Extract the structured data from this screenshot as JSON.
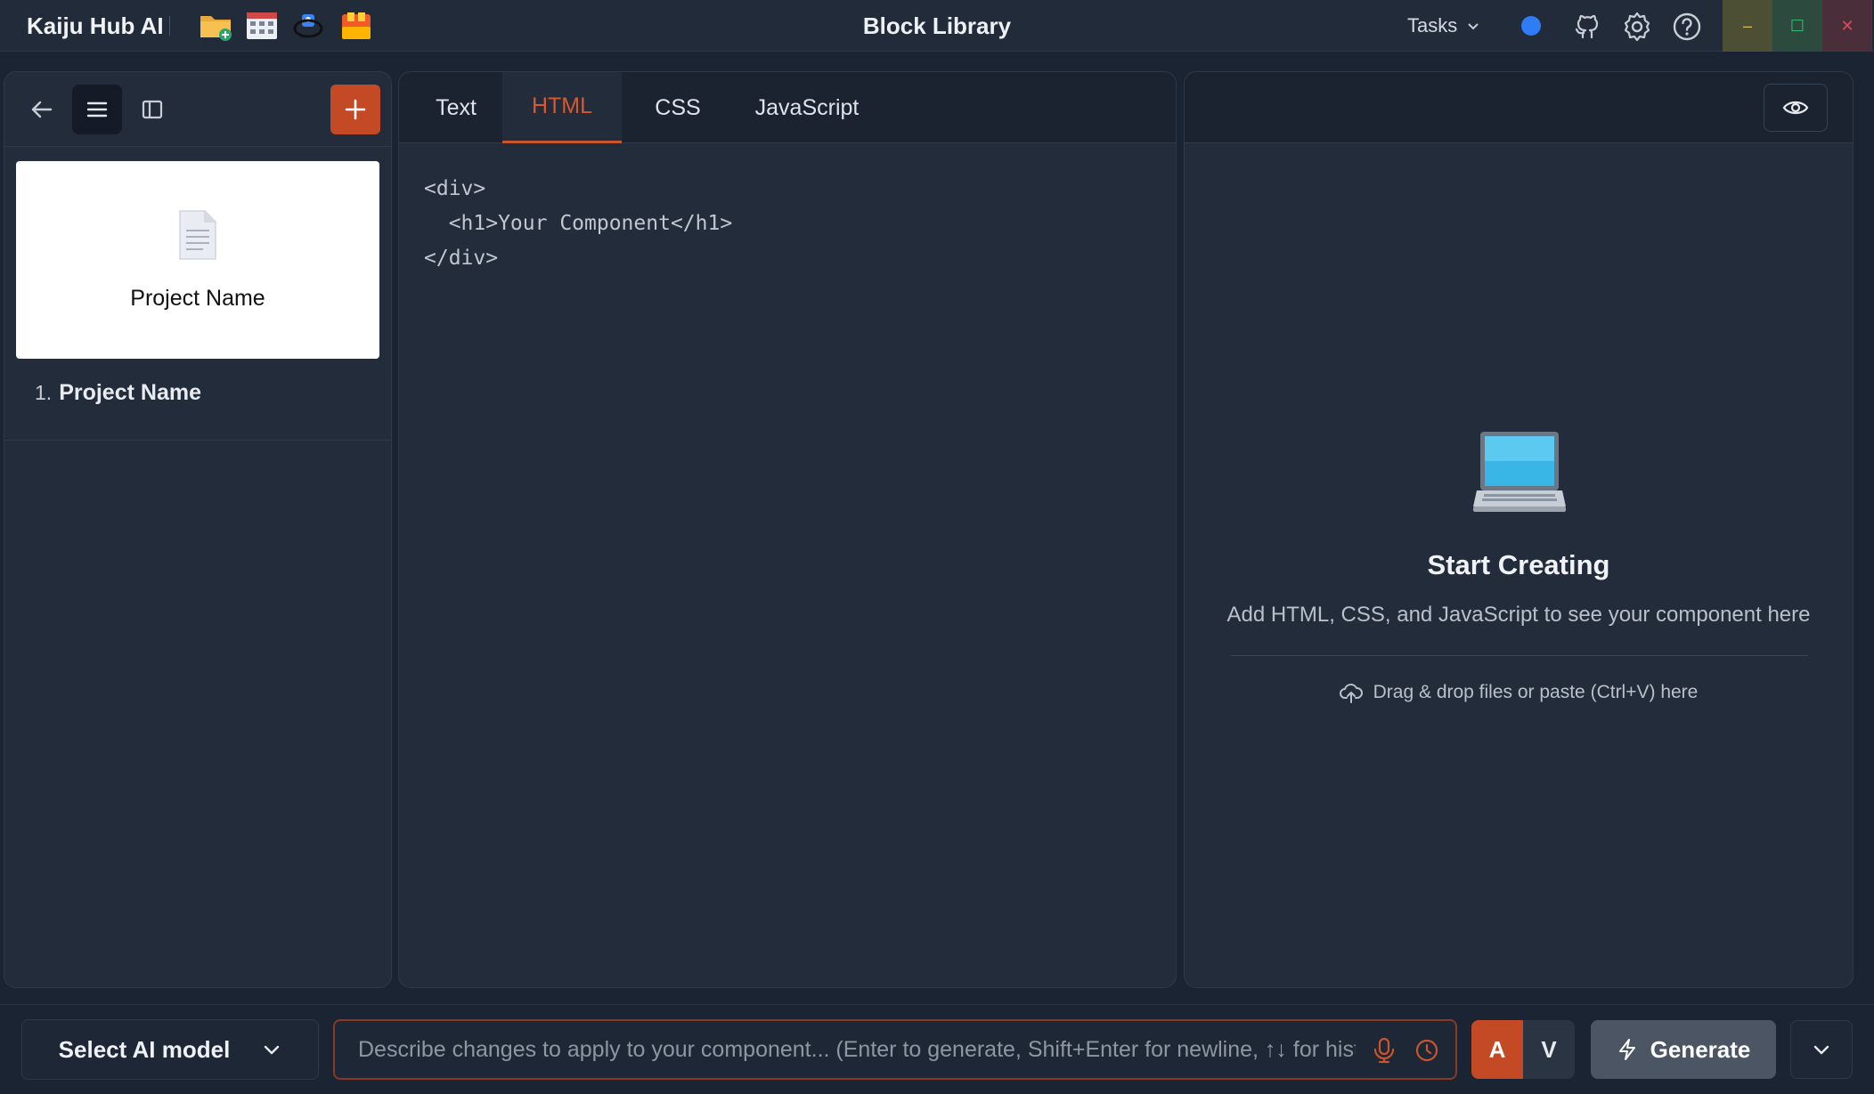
{
  "titlebar": {
    "app_name": "Kaiju Hub AI",
    "window_title": "Block Library",
    "tasks_label": "Tasks",
    "quick_icons": [
      "folder-add-icon",
      "calendar-grid-icon",
      "sync-app-icon",
      "palette-app-icon"
    ],
    "right_icons": [
      "status-dot",
      "github-icon",
      "gear-icon",
      "help-icon"
    ],
    "window_controls": [
      "minimize-icon",
      "maximize-icon",
      "close-icon"
    ],
    "minimize_glyph": "–",
    "maximize_glyph": "☐",
    "close_glyph": "✕"
  },
  "sidebar": {
    "card": {
      "title": "Project Name"
    },
    "items": [
      {
        "number": "1.",
        "label": "Project Name"
      }
    ]
  },
  "editor": {
    "tabs": [
      {
        "label": "Text",
        "active": false
      },
      {
        "label": "HTML",
        "active": true
      },
      {
        "label": "CSS",
        "active": false
      },
      {
        "label": "JavaScript",
        "active": false
      }
    ],
    "code_lines": [
      "<div>",
      "  <h1>Your Component</h1>",
      "</div>"
    ]
  },
  "preview": {
    "title": "Start Creating",
    "subtitle": "Add HTML, CSS, and JavaScript to see your component here",
    "drop_hint": "Drag & drop files or paste (Ctrl+V) here"
  },
  "bottombar": {
    "model_select_label": "Select AI model",
    "prompt_value": "",
    "prompt_placeholder": "Describe changes to apply to your component... (Enter to generate, Shift+Enter for newline, ↑↓ for hist",
    "btn_a": "A",
    "btn_v": "V",
    "generate_label": "Generate"
  },
  "colors": {
    "accent": "#c44a25",
    "panel_bg": "#222c3b",
    "app_bg": "#1b2433",
    "status_dot": "#2f7cf6"
  }
}
